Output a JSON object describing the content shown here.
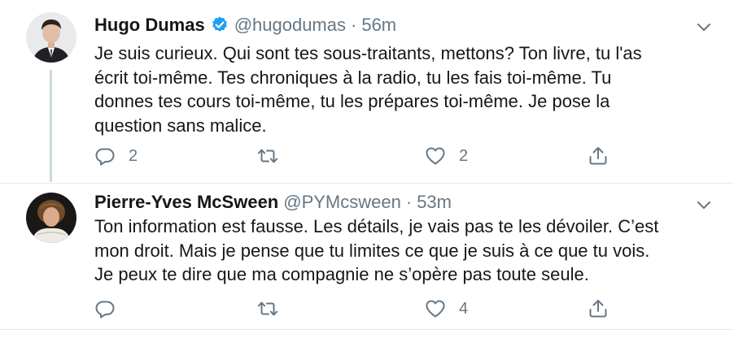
{
  "tweets": [
    {
      "name": "Hugo Dumas",
      "verified": true,
      "handle": "@hugodumas",
      "dot": "·",
      "time": "56m",
      "text": "Je suis curieux. Qui sont tes sous-traitants, mettons? Ton livre, tu l'as\nécrit toi-même. Tes chroniques à la radio, tu les fais toi-même. Tu\ndonnes tes cours toi-même, tu les prépares toi-même. Je pose la\nquestion sans malice.",
      "reply_count": "2",
      "retweet_count": "",
      "like_count": "2"
    },
    {
      "name": "Pierre-Yves McSween",
      "verified": false,
      "handle": "@PYMcsween",
      "dot": "·",
      "time": "53m",
      "text": "Ton information est fausse. Les détails, je vais pas te les dévoiler. C’est\nmon droit. Mais je pense que tu limites ce que je suis à ce que tu vois.\nJe peux te dire que ma compagnie ne s’opère pas toute seule.",
      "reply_count": "",
      "retweet_count": "",
      "like_count": "4"
    }
  ],
  "icons": {
    "reply": "reply-icon",
    "retweet": "retweet-icon",
    "like": "heart-icon",
    "share": "share-icon",
    "more": "chevron-down-icon",
    "verified": "verified-badge-icon"
  },
  "colors": {
    "text": "#14171a",
    "muted": "#657786",
    "verified_blue": "#1da1f2",
    "thread_line": "#ccd6dd",
    "divider": "#e6ecf0"
  }
}
